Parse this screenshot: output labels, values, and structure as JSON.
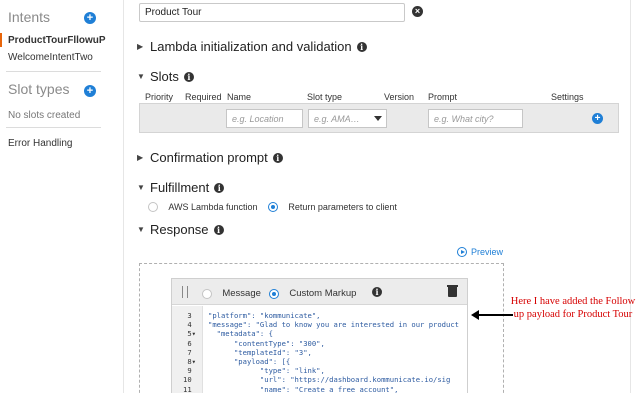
{
  "sidebar": {
    "intents_heading": "Intents",
    "intents": [
      "ProductTourFllowuP",
      "WelcomeIntentTwo"
    ],
    "slot_types_heading": "Slot types",
    "no_slots": "No slots created",
    "error_handling": "Error Handling"
  },
  "main": {
    "intent_name": "Product Tour",
    "lambda_section": "Lambda initialization and validation",
    "slots_section": "Slots",
    "slot_columns": [
      "Priority",
      "Required",
      "Name",
      "Slot type",
      "Version",
      "Prompt",
      "Settings"
    ],
    "slot_name_placeholder": "e.g. Location",
    "slot_type_placeholder": "e.g. AMA…",
    "slot_prompt_placeholder": "e.g. What city?",
    "confirmation_section": "Confirmation prompt",
    "fulfillment_section": "Fulfillment",
    "fulfillment_options": [
      {
        "label": "AWS Lambda function",
        "selected": false
      },
      {
        "label": "Return parameters to client",
        "selected": true
      }
    ],
    "response_section": "Response",
    "preview": "Preview"
  },
  "editor": {
    "message_option": "Message",
    "custom_markup_option": "Custom Markup",
    "selected_option": "Custom Markup",
    "lines": [
      {
        "n": "3",
        "fold": "",
        "code": "\"platform\": \"kommunicate\","
      },
      {
        "n": "4",
        "fold": "",
        "code": "\"message\": \"Glad to know you are interested in our product"
      },
      {
        "n": "5",
        "fold": "▾",
        "code": "  \"metadata\": {"
      },
      {
        "n": "6",
        "fold": "",
        "code": "      \"contentType\": \"300\","
      },
      {
        "n": "7",
        "fold": "",
        "code": "      \"templateId\": \"3\","
      },
      {
        "n": "8",
        "fold": "▾",
        "code": "      \"payload\": [{"
      },
      {
        "n": "9",
        "fold": "",
        "code": "            \"type\": \"link\","
      },
      {
        "n": "10",
        "fold": "",
        "code": "            \"url\": \"https://dashboard.kommunicate.io/sig"
      },
      {
        "n": "11",
        "fold": "",
        "code": "            \"name\": \"Create a free account\","
      }
    ]
  },
  "annotation": {
    "text": "Here I have added  the Follow up payload for Product Tour",
    "color": "#d60000"
  },
  "colors": {
    "accent": "#1f7fd6",
    "active_marker": "#e8650a"
  }
}
